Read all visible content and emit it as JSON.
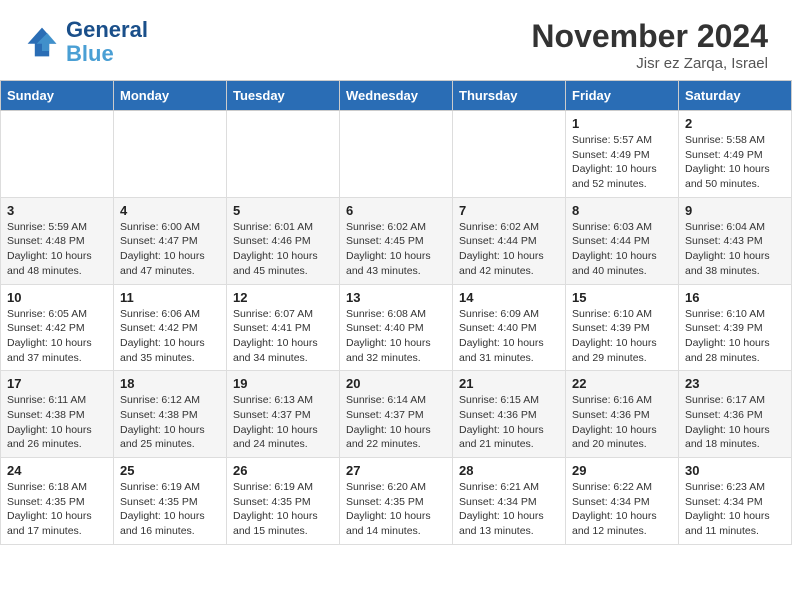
{
  "header": {
    "logo_line1": "General",
    "logo_line2": "Blue",
    "month": "November 2024",
    "location": "Jisr ez Zarqa, Israel"
  },
  "weekdays": [
    "Sunday",
    "Monday",
    "Tuesday",
    "Wednesday",
    "Thursday",
    "Friday",
    "Saturday"
  ],
  "weeks": [
    [
      {
        "day": "",
        "info": ""
      },
      {
        "day": "",
        "info": ""
      },
      {
        "day": "",
        "info": ""
      },
      {
        "day": "",
        "info": ""
      },
      {
        "day": "",
        "info": ""
      },
      {
        "day": "1",
        "info": "Sunrise: 5:57 AM\nSunset: 4:49 PM\nDaylight: 10 hours\nand 52 minutes."
      },
      {
        "day": "2",
        "info": "Sunrise: 5:58 AM\nSunset: 4:49 PM\nDaylight: 10 hours\nand 50 minutes."
      }
    ],
    [
      {
        "day": "3",
        "info": "Sunrise: 5:59 AM\nSunset: 4:48 PM\nDaylight: 10 hours\nand 48 minutes."
      },
      {
        "day": "4",
        "info": "Sunrise: 6:00 AM\nSunset: 4:47 PM\nDaylight: 10 hours\nand 47 minutes."
      },
      {
        "day": "5",
        "info": "Sunrise: 6:01 AM\nSunset: 4:46 PM\nDaylight: 10 hours\nand 45 minutes."
      },
      {
        "day": "6",
        "info": "Sunrise: 6:02 AM\nSunset: 4:45 PM\nDaylight: 10 hours\nand 43 minutes."
      },
      {
        "day": "7",
        "info": "Sunrise: 6:02 AM\nSunset: 4:44 PM\nDaylight: 10 hours\nand 42 minutes."
      },
      {
        "day": "8",
        "info": "Sunrise: 6:03 AM\nSunset: 4:44 PM\nDaylight: 10 hours\nand 40 minutes."
      },
      {
        "day": "9",
        "info": "Sunrise: 6:04 AM\nSunset: 4:43 PM\nDaylight: 10 hours\nand 38 minutes."
      }
    ],
    [
      {
        "day": "10",
        "info": "Sunrise: 6:05 AM\nSunset: 4:42 PM\nDaylight: 10 hours\nand 37 minutes."
      },
      {
        "day": "11",
        "info": "Sunrise: 6:06 AM\nSunset: 4:42 PM\nDaylight: 10 hours\nand 35 minutes."
      },
      {
        "day": "12",
        "info": "Sunrise: 6:07 AM\nSunset: 4:41 PM\nDaylight: 10 hours\nand 34 minutes."
      },
      {
        "day": "13",
        "info": "Sunrise: 6:08 AM\nSunset: 4:40 PM\nDaylight: 10 hours\nand 32 minutes."
      },
      {
        "day": "14",
        "info": "Sunrise: 6:09 AM\nSunset: 4:40 PM\nDaylight: 10 hours\nand 31 minutes."
      },
      {
        "day": "15",
        "info": "Sunrise: 6:10 AM\nSunset: 4:39 PM\nDaylight: 10 hours\nand 29 minutes."
      },
      {
        "day": "16",
        "info": "Sunrise: 6:10 AM\nSunset: 4:39 PM\nDaylight: 10 hours\nand 28 minutes."
      }
    ],
    [
      {
        "day": "17",
        "info": "Sunrise: 6:11 AM\nSunset: 4:38 PM\nDaylight: 10 hours\nand 26 minutes."
      },
      {
        "day": "18",
        "info": "Sunrise: 6:12 AM\nSunset: 4:38 PM\nDaylight: 10 hours\nand 25 minutes."
      },
      {
        "day": "19",
        "info": "Sunrise: 6:13 AM\nSunset: 4:37 PM\nDaylight: 10 hours\nand 24 minutes."
      },
      {
        "day": "20",
        "info": "Sunrise: 6:14 AM\nSunset: 4:37 PM\nDaylight: 10 hours\nand 22 minutes."
      },
      {
        "day": "21",
        "info": "Sunrise: 6:15 AM\nSunset: 4:36 PM\nDaylight: 10 hours\nand 21 minutes."
      },
      {
        "day": "22",
        "info": "Sunrise: 6:16 AM\nSunset: 4:36 PM\nDaylight: 10 hours\nand 20 minutes."
      },
      {
        "day": "23",
        "info": "Sunrise: 6:17 AM\nSunset: 4:36 PM\nDaylight: 10 hours\nand 18 minutes."
      }
    ],
    [
      {
        "day": "24",
        "info": "Sunrise: 6:18 AM\nSunset: 4:35 PM\nDaylight: 10 hours\nand 17 minutes."
      },
      {
        "day": "25",
        "info": "Sunrise: 6:19 AM\nSunset: 4:35 PM\nDaylight: 10 hours\nand 16 minutes."
      },
      {
        "day": "26",
        "info": "Sunrise: 6:19 AM\nSunset: 4:35 PM\nDaylight: 10 hours\nand 15 minutes."
      },
      {
        "day": "27",
        "info": "Sunrise: 6:20 AM\nSunset: 4:35 PM\nDaylight: 10 hours\nand 14 minutes."
      },
      {
        "day": "28",
        "info": "Sunrise: 6:21 AM\nSunset: 4:34 PM\nDaylight: 10 hours\nand 13 minutes."
      },
      {
        "day": "29",
        "info": "Sunrise: 6:22 AM\nSunset: 4:34 PM\nDaylight: 10 hours\nand 12 minutes."
      },
      {
        "day": "30",
        "info": "Sunrise: 6:23 AM\nSunset: 4:34 PM\nDaylight: 10 hours\nand 11 minutes."
      }
    ]
  ]
}
